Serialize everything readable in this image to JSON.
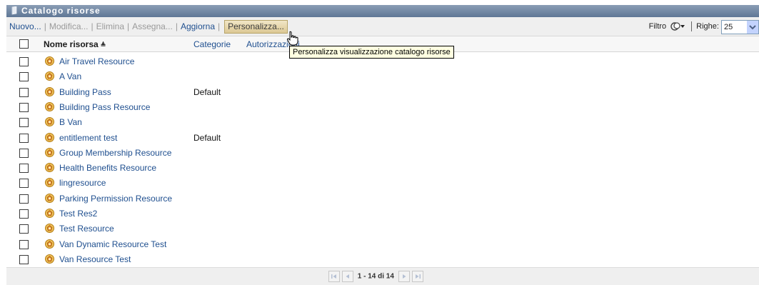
{
  "title": "Catalogo risorse",
  "toolbar": {
    "actions": [
      {
        "label": "Nuovo...",
        "enabled": true
      },
      {
        "label": "Modifica...",
        "enabled": false
      },
      {
        "label": "Elimina",
        "enabled": false
      },
      {
        "label": "Assegna...",
        "enabled": false
      },
      {
        "label": "Aggiorna",
        "enabled": true
      },
      {
        "label": "Personalizza...",
        "enabled": true
      }
    ],
    "filter_label": "Filtro",
    "rows_label": "Righe:",
    "rows_value": "25"
  },
  "table": {
    "headers": {
      "nome": "Nome risorsa",
      "categorie": "Categorie",
      "autorizzazioni": "Autorizzazioni"
    },
    "sort_indicator": "≜",
    "rows": [
      {
        "name": "Air Travel Resource",
        "category": ""
      },
      {
        "name": "A Van",
        "category": ""
      },
      {
        "name": "Building Pass",
        "category": "Default"
      },
      {
        "name": "Building Pass Resource",
        "category": ""
      },
      {
        "name": "B Van",
        "category": ""
      },
      {
        "name": "entitlement test",
        "category": "Default"
      },
      {
        "name": "Group Membership Resource",
        "category": ""
      },
      {
        "name": "Health Benefits Resource",
        "category": ""
      },
      {
        "name": "lingresource",
        "category": ""
      },
      {
        "name": "Parking Permission Resource",
        "category": ""
      },
      {
        "name": "Test Res2",
        "category": ""
      },
      {
        "name": "Test Resource",
        "category": ""
      },
      {
        "name": "Van Dynamic Resource Test",
        "category": ""
      },
      {
        "name": "Van Resource Test",
        "category": ""
      }
    ]
  },
  "pagination": {
    "text": "1 - 14 di 14"
  },
  "tooltip": "Personalizza visualizzazione catalogo risorse",
  "colors": {
    "title_bar": "#6d84a4",
    "link": "#1f4f8f",
    "toolbar_bg": "#efefef"
  }
}
